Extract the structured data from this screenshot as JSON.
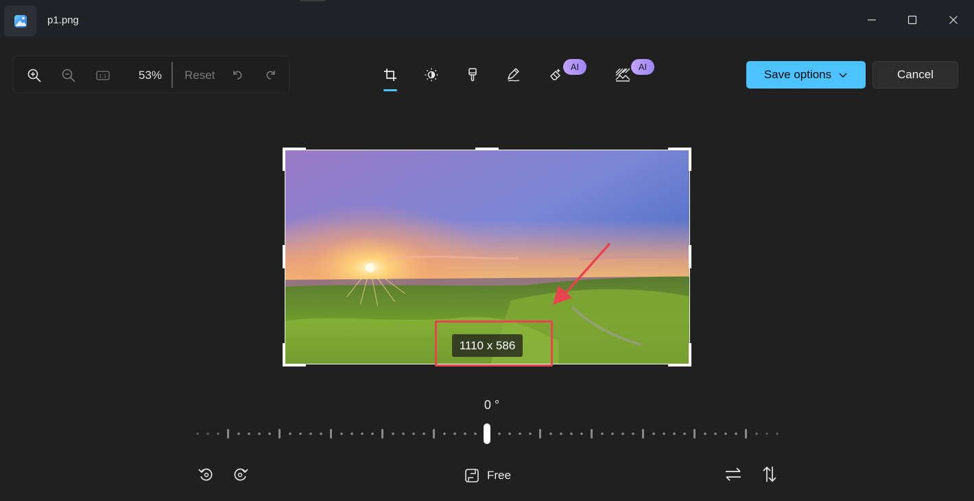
{
  "window": {
    "title": "p1.png"
  },
  "toolbar": {
    "zoom_in_icon": "zoom-in-icon",
    "zoom_out_icon": "zoom-out-icon",
    "actual_size_icon": "actual-size-icon",
    "zoom_level": "53%",
    "reset_label": "Reset",
    "undo_icon": "undo-icon",
    "redo_icon": "redo-icon"
  },
  "tools": [
    {
      "name": "crop",
      "icon": "crop-icon",
      "active": true
    },
    {
      "name": "adjust",
      "icon": "brightness-icon",
      "active": false
    },
    {
      "name": "filter",
      "icon": "brush-icon",
      "active": false
    },
    {
      "name": "markup",
      "icon": "pen-icon",
      "active": false
    },
    {
      "name": "erase",
      "icon": "eraser-icon",
      "badge": "AI",
      "active": false
    },
    {
      "name": "background",
      "icon": "background-blur-icon",
      "badge": "AI",
      "active": false
    }
  ],
  "badges": {
    "ai_1": "AI",
    "ai_2": "AI"
  },
  "actions": {
    "save_label": "Save options",
    "cancel_label": "Cancel"
  },
  "image": {
    "size_label": "1110 x 586"
  },
  "rotation": {
    "angle_label": "0 °"
  },
  "bottom": {
    "rotate_left_icon": "rotate-left-icon",
    "rotate_right_icon": "rotate-right-icon",
    "aspect_label": "Free",
    "flip_horizontal_icon": "flip-horizontal-icon",
    "flip_vertical_icon": "flip-vertical-icon"
  },
  "colors": {
    "accent": "#4cc2ff",
    "background": "#202020",
    "annotation_red": "#e9434f"
  }
}
